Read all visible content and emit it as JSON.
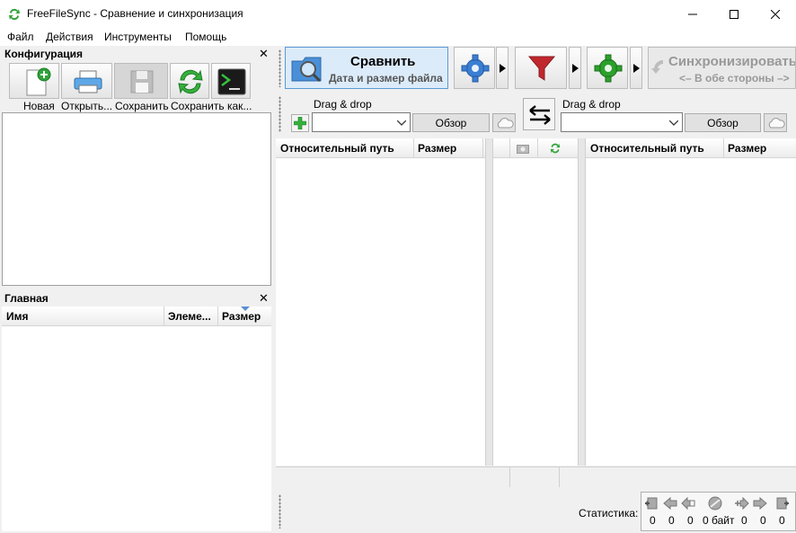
{
  "window": {
    "title": "FreeFileSync - Сравнение и синхронизация"
  },
  "menu": {
    "file": "Файл",
    "actions": "Действия",
    "tools": "Инструменты",
    "help": "Помощь"
  },
  "config_panel": {
    "title": "Конфигурация",
    "buttons": {
      "new": "Новая",
      "open": "Открыть...",
      "save": "Сохранить",
      "save_as": "Сохранить как..."
    }
  },
  "overview_panel": {
    "title": "Главная",
    "columns": {
      "name": "Имя",
      "items": "Элеме...",
      "size": "Размер"
    }
  },
  "toolbar": {
    "compare_title": "Сравнить",
    "compare_subtitle": "Дата и размер файла",
    "sync_title": "Синхронизировать",
    "sync_subtitle": "<– В обе стороны –>"
  },
  "folders": {
    "left": {
      "label": "Drag & drop",
      "value": "",
      "browse": "Обзор"
    },
    "right": {
      "label": "Drag & drop",
      "value": "",
      "browse": "Обзор"
    }
  },
  "grid": {
    "left_cols": {
      "path": "Относительный путь",
      "size": "Размер"
    },
    "right_cols": {
      "path": "Относительный путь",
      "size": "Размер"
    }
  },
  "statistics": {
    "label": "Статистика:",
    "values": [
      "0",
      "0",
      "0",
      "0 байт",
      "0",
      "0",
      "0"
    ]
  },
  "colors": {
    "accent_blue": "#5b9bd5",
    "compare_bg": "#dcebfa",
    "green": "#2ca02c",
    "red": "#c0272d"
  }
}
